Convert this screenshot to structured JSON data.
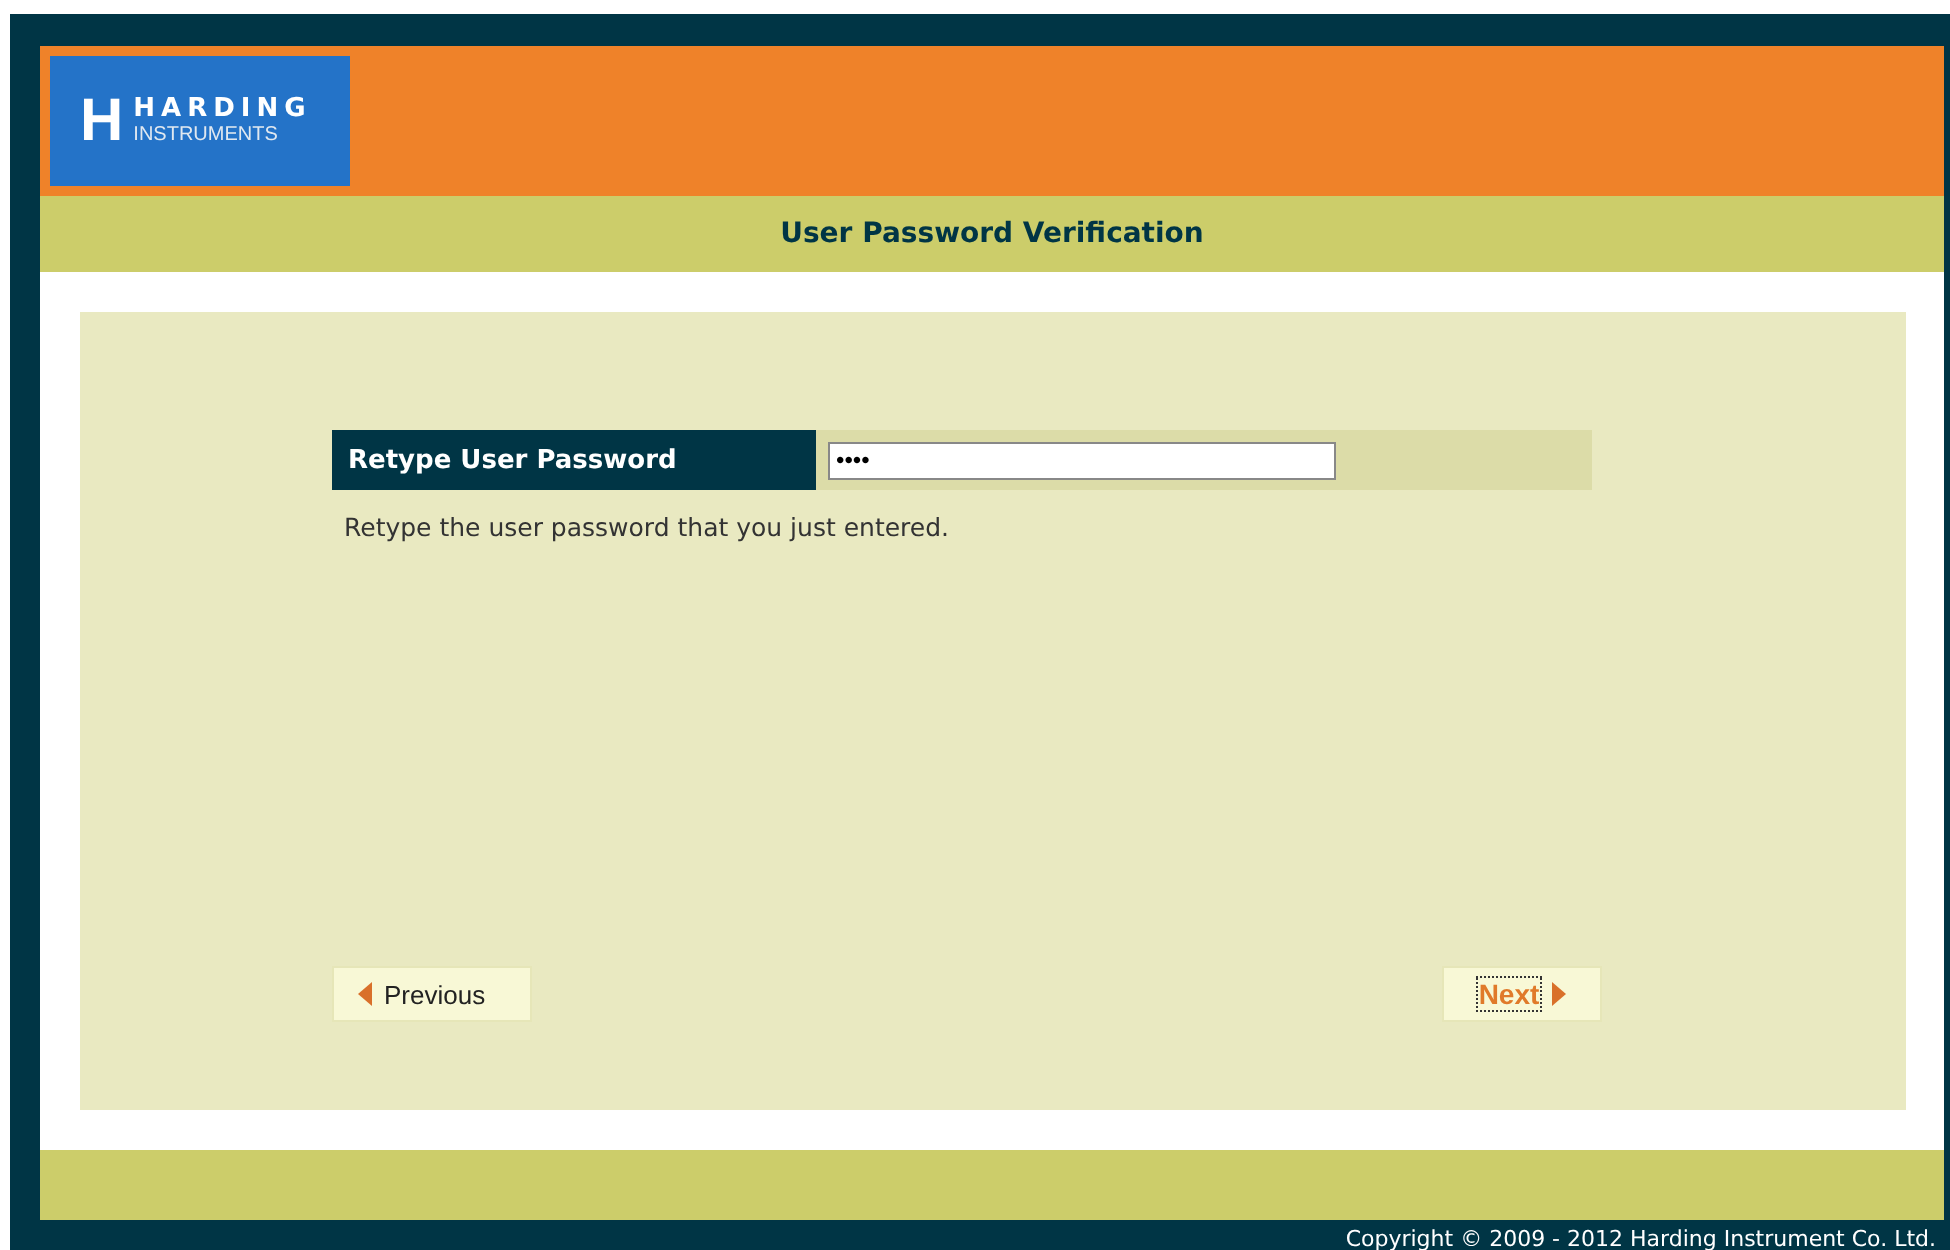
{
  "logo": {
    "mark": "H",
    "name": "HARDING",
    "subtitle": "INSTRUMENTS"
  },
  "title": "User Password Verification",
  "form": {
    "label": "Retype User Password",
    "value": "••••",
    "help": "Retype the user password that you just entered."
  },
  "buttons": [
    {
      "kind": "previous",
      "label": "Previous",
      "focused": false
    },
    {
      "kind": "next",
      "label": "Next",
      "focused": true
    }
  ],
  "copyright": "Copyright © 2009 - 2012 Harding Instrument Co. Ltd."
}
